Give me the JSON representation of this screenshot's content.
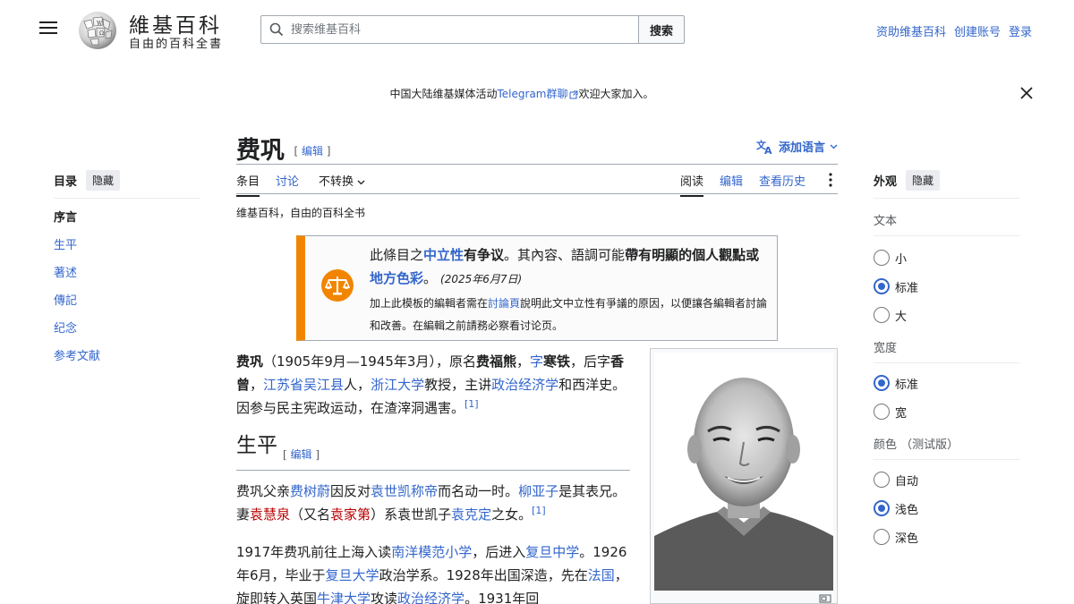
{
  "header": {
    "logo_title": "維基百科",
    "logo_tagline": "自由的百科全書",
    "search_placeholder": "搜索维基百科",
    "search_button": "搜索",
    "links": [
      "资助维基百科",
      "创建账号",
      "登录"
    ]
  },
  "banner": {
    "text_before": "中国大陆维基媒体活动",
    "link": "Telegram群聊",
    "text_after": "欢迎大家加入。"
  },
  "toc": {
    "title": "目录",
    "hide": "隐藏",
    "items": [
      "序言",
      "生平",
      "著述",
      "傳記",
      "纪念",
      "参考文献"
    ]
  },
  "article": {
    "title": "费巩",
    "edit": "编辑",
    "add_language": "添加语言",
    "tabs_left": [
      "条目",
      "讨论",
      "不转换"
    ],
    "tabs_right": [
      "阅读",
      "编辑",
      "查看历史"
    ],
    "tagline": "维基百科，自由的百科全书"
  },
  "ambox": {
    "p1": "此條目之",
    "neutral": "中立性",
    "p2": "有争议",
    "p3": "。其內容、語調可能",
    "p4": "帶有明顯的個人觀點",
    "p5": "或",
    "regional": "地方色彩",
    "p6": "。",
    "date": "(2025年6月7日)",
    "sub1": "加上此模板的編輯者需在",
    "talk_link": "討論頁",
    "sub2": "說明此文中立性有爭議的原因，以便讓各編輯者討論和改善。在編輯之前請務必察看讨论页。"
  },
  "intro": {
    "name": "费巩",
    "t1": "（1905年9月—1945年3月），原名",
    "orig_name": "费福熊",
    "t2": "，",
    "zi_link": "字",
    "courtesy": "寒铁",
    "t3": "，后字",
    "later_zi": "香曾",
    "t4": "，",
    "hometown": "江苏省吴江县",
    "t5": "人，",
    "university": "浙江大学",
    "t6": "教授，主讲",
    "subject": "政治经济学",
    "t7": "和西洋史。因参与民主宪政运动，在渣滓洞遇害。",
    "ref": "[1]"
  },
  "section": {
    "title": "生平",
    "edit": "编辑"
  },
  "para2": {
    "t1": "费巩父亲",
    "father": "费树蔚",
    "t2": "因反对",
    "yuan": "袁世凯称帝",
    "t3": "而名动一时。",
    "liu": "柳亚子",
    "t4": "是其表兄。妻",
    "wife": "袁慧泉",
    "t5": "（又名",
    "wife_alias": "袁家第",
    "t6": "）系袁世凯子",
    "kd": "袁克定",
    "t7": "之女。",
    "ref": "[1]"
  },
  "para3": {
    "t1": "1917年费巩前往上海入读",
    "school1": "南洋模范小学",
    "t2": "，后进入",
    "school2": "复旦中学",
    "t3": "。1926年6月，毕业于",
    "school3": "复旦大学",
    "t4": "政治学系。1928年出国深造，先在",
    "france": "法国",
    "t5": "，旋即转入英国",
    "oxford": "牛津大学",
    "t6": "攻读",
    "pe": "政治经济学",
    "t7": "。1931年回"
  },
  "appearance": {
    "title": "外观",
    "hide": "隐藏",
    "groups": [
      {
        "label": "文本",
        "options": [
          "小",
          "标准",
          "大"
        ],
        "selected": 1
      },
      {
        "label": "宽度",
        "options": [
          "标准",
          "宽"
        ],
        "selected": 0
      },
      {
        "label": "颜色 （测试版）",
        "options": [
          "自动",
          "浅色",
          "深色"
        ],
        "selected": 1
      }
    ]
  },
  "colors": {
    "link": "#3366cc",
    "redlink": "#ba0000",
    "ambox_border": "#f28500"
  }
}
